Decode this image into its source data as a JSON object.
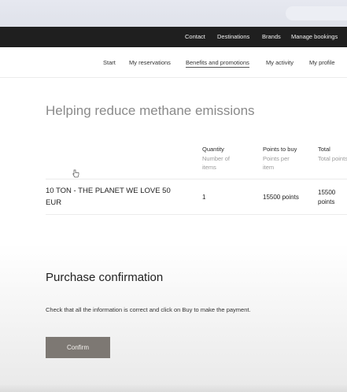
{
  "topbar": {
    "links": [
      "Contact",
      "Destinations",
      "Brands",
      "Manage bookings"
    ]
  },
  "subnav": {
    "links": [
      "Start",
      "My reservations",
      "Benefits and promotions",
      "My activity",
      "My profile"
    ],
    "active": "Benefits and promotions"
  },
  "section": {
    "title": "Helping reduce methane emissions"
  },
  "table": {
    "headers": [
      {
        "label": "Quantity",
        "sub": "Number of items"
      },
      {
        "label": "Points to buy",
        "sub": "Points per item"
      },
      {
        "label": "Total",
        "sub": "Total points"
      }
    ],
    "sub_lines": {
      "quantity_1": "Number of",
      "quantity_2": "items",
      "points_1": "Points per",
      "points_2": "item",
      "total_1": "Total points"
    },
    "row": {
      "name_line1": "10 TON - THE PLANET WE LOVE 50",
      "name_line2": "EUR",
      "quantity": "1",
      "points": "15500 points",
      "total_line1": "15500",
      "total_line2": "points"
    }
  },
  "purchase": {
    "title": "Purchase confirmation",
    "instruction": "Check that all the information is correct and click on Buy to make the payment.",
    "confirm_label": "Confirm"
  }
}
